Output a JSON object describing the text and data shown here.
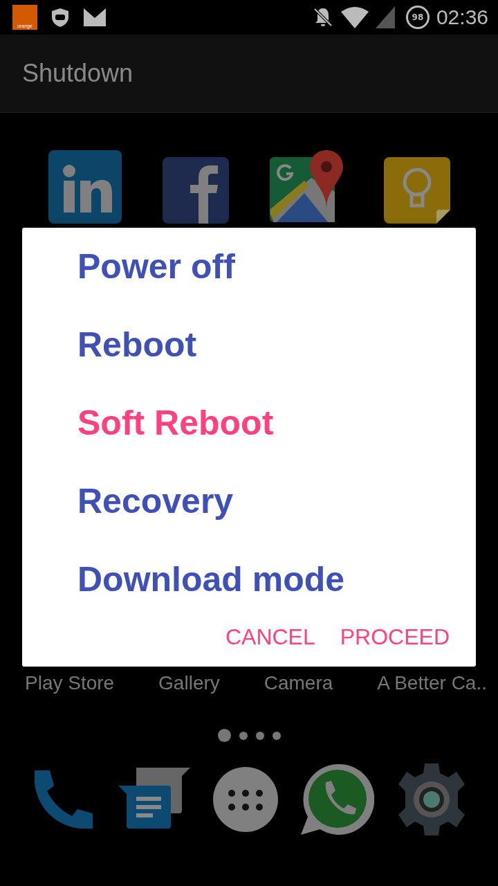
{
  "status_bar": {
    "carrier": "orange",
    "battery": "98",
    "time": "02:36"
  },
  "app_bar": {
    "title": "Shutdown"
  },
  "home_icons": [
    {
      "kind": "linkedin"
    },
    {
      "kind": "facebook"
    },
    {
      "kind": "maps"
    },
    {
      "kind": "keep"
    }
  ],
  "dialog": {
    "options": [
      {
        "label": "Power off",
        "selected": false
      },
      {
        "label": "Reboot",
        "selected": false
      },
      {
        "label": "Soft Reboot",
        "selected": true
      },
      {
        "label": "Recovery",
        "selected": false
      },
      {
        "label": "Download mode",
        "selected": false
      }
    ],
    "buttons": [
      "CANCEL",
      "PROCEED"
    ]
  },
  "app_labels": [
    "Play Store",
    "Gallery",
    "Camera",
    "A Better Ca.."
  ],
  "page_dots": [
    {
      "selected": true
    },
    {
      "selected": false
    },
    {
      "selected": false
    },
    {
      "selected": false
    }
  ],
  "dock": [
    {
      "kind": "phone"
    },
    {
      "kind": "messages"
    },
    {
      "kind": "apps"
    },
    {
      "kind": "whatsapp"
    },
    {
      "kind": "settings"
    }
  ]
}
